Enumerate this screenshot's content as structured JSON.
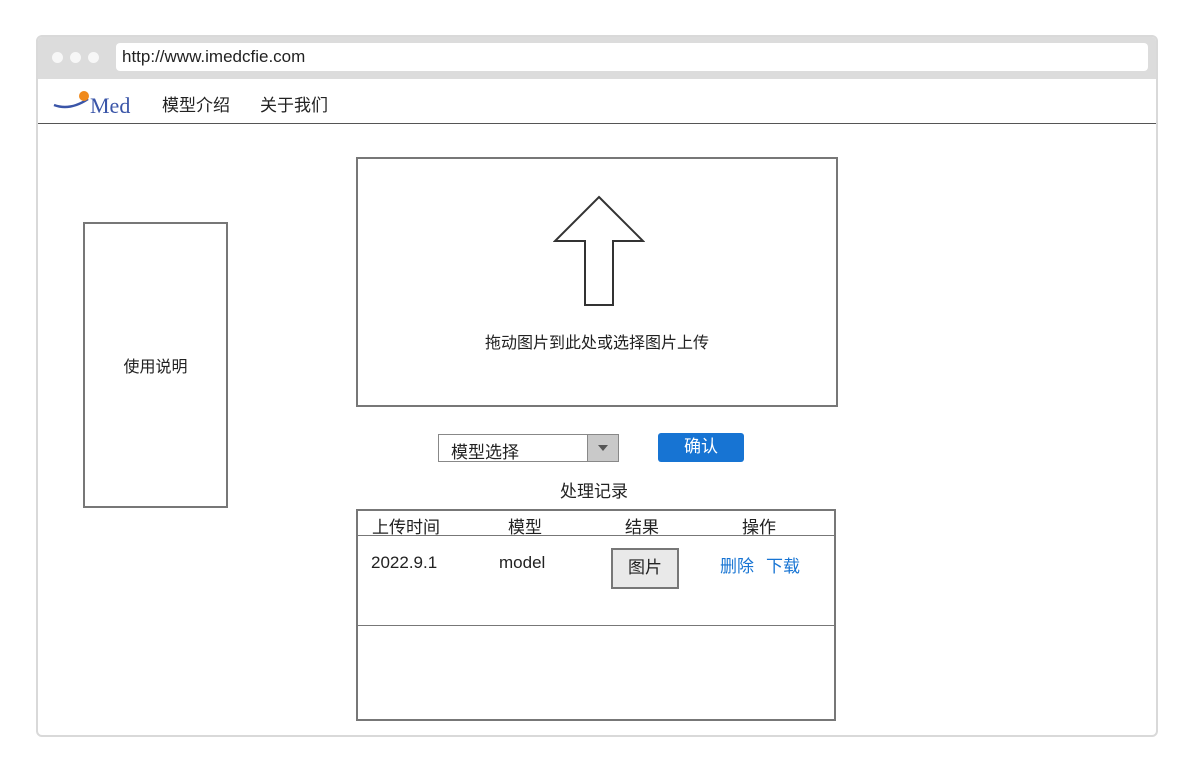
{
  "browser": {
    "url": "http://www.imedcfie.com"
  },
  "nav": {
    "logo_text": "Med",
    "links": [
      "模型介绍",
      "关于我们"
    ]
  },
  "sidebar": {
    "instructions_label": "使用说明"
  },
  "upload": {
    "prompt": "拖动图片到此处或选择图片上传"
  },
  "model_select": {
    "selected": "模型选择"
  },
  "confirm_button": "确认",
  "records": {
    "title": "处理记录",
    "columns": [
      "上传时间",
      "模型",
      "结果",
      "操作"
    ],
    "rows": [
      {
        "upload_time": "2022.9.1",
        "model": "model",
        "result_button": "图片",
        "actions": [
          "删除",
          "下载"
        ]
      }
    ]
  },
  "colors": {
    "accent": "#1774d3",
    "logo_blue": "#3a55a8",
    "logo_orange": "#f08a1c"
  }
}
